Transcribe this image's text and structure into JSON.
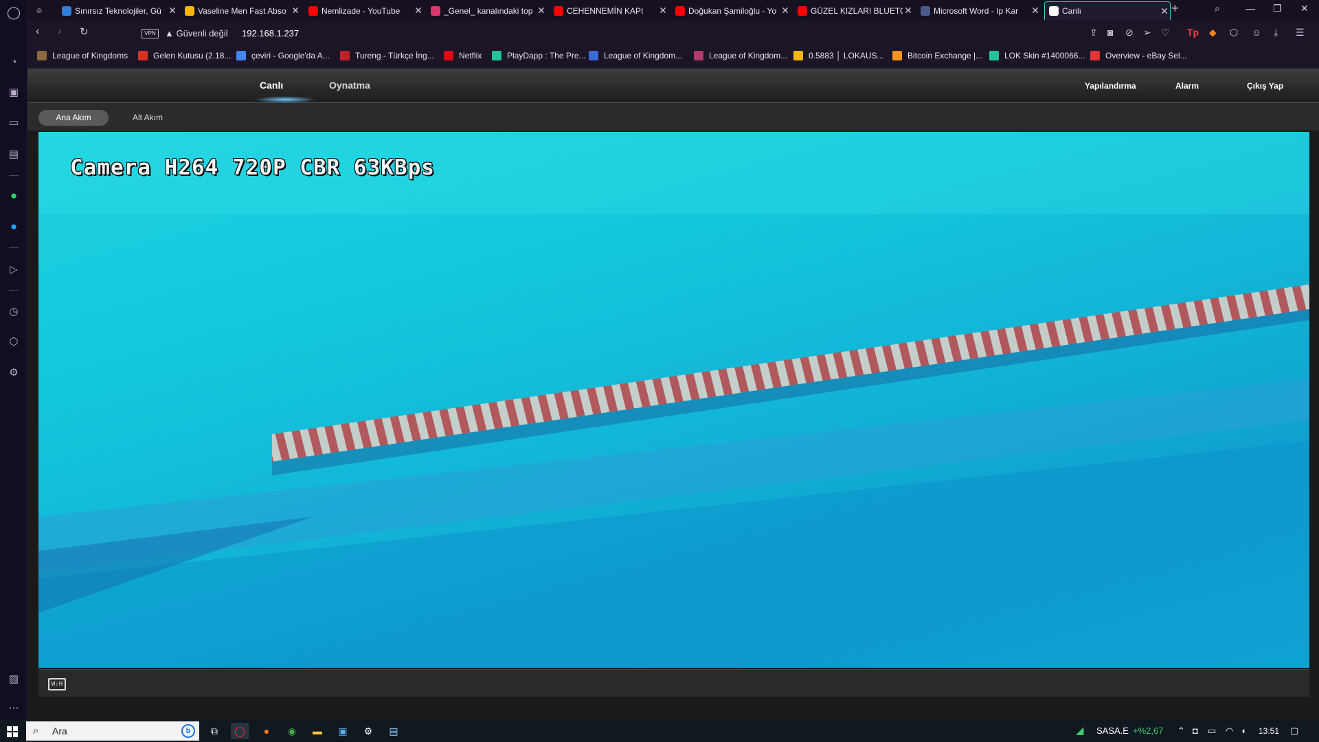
{
  "browser": {
    "tabs": [
      {
        "title": "Sınırsız Teknolojiler, Gü",
        "icon": "triangle-logo-icon",
        "color": "#2f7fd8"
      },
      {
        "title": "Vaseline Men Fast Abso",
        "icon": "walmart-icon",
        "color": "#f7b500"
      },
      {
        "title": "Nemlizade - YouTube",
        "icon": "youtube-icon",
        "color": "#ff0000"
      },
      {
        "title": "_Genel_ kanalındaki top",
        "icon": "play-icon",
        "color": "#e0356e"
      },
      {
        "title": "CEHENNEMİN KAPI",
        "icon": "youtube-icon",
        "color": "#ff0000"
      },
      {
        "title": "Doğukan Şamiloğlu - Yo",
        "icon": "youtube-icon",
        "color": "#ff0000"
      },
      {
        "title": "GÜZEL KIZLARI BLUETO",
        "icon": "youtube-icon",
        "color": "#ff0000"
      },
      {
        "title": "Microsoft Word - Ip Kar",
        "icon": "document-icon",
        "color": "#4a5a8a"
      },
      {
        "title": "Canlı",
        "icon": "globe-icon",
        "color": "#ffffff",
        "active": true
      }
    ],
    "security_label": "Güvenli değil",
    "vpn_label": "VPN",
    "url": "192.168.1.237",
    "bookmarks": [
      {
        "label": "League of Kingdoms",
        "icon": "game-icon",
        "color": "#8a6a3a"
      },
      {
        "label": "Gelen Kutusu (2.18...",
        "icon": "gmail-icon",
        "color": "#d93025"
      },
      {
        "label": "çeviri - Google'da A...",
        "icon": "google-icon",
        "color": "#4285f4"
      },
      {
        "label": "Tureng - Türkçe İng...",
        "icon": "tureng-icon",
        "color": "#c0202a"
      },
      {
        "label": "Netflix",
        "icon": "netflix-icon",
        "color": "#e50914"
      },
      {
        "label": "PlayDapp : The Pre...",
        "icon": "playdapp-icon",
        "color": "#22c39b"
      },
      {
        "label": "League of Kingdom...",
        "icon": "lok-icon",
        "color": "#3a6ad8"
      },
      {
        "label": "League of Kingdom...",
        "icon": "lok-market-icon",
        "color": "#b03a6a"
      },
      {
        "label": "0.5883 │ LOKAUS...",
        "icon": "binance-icon",
        "color": "#f0b90b"
      },
      {
        "label": "Bitcoin Exchange |...",
        "icon": "bitcoin-icon",
        "color": "#f7931a"
      },
      {
        "label": "LOK Skin #1400066...",
        "icon": "opensea-icon",
        "color": "#22c39b"
      },
      {
        "label": "Overview - eBay Sel...",
        "icon": "ebay-icon",
        "color": "#e53238"
      }
    ]
  },
  "app": {
    "nav": {
      "live": "Canlı",
      "playback": "Oynatma",
      "config": "Yapılandırma",
      "alarm": "Alarm",
      "logout": "Çıkış Yap"
    },
    "streams": {
      "main": "Ana Akım",
      "sub": "Alt Akım"
    },
    "video": {
      "osd_text": "Camera H264 720P CBR 63KBps"
    },
    "controls": {
      "stretch_label": "W:H"
    }
  },
  "taskbar": {
    "search_placeholder": "Ara",
    "stock_symbol": "SASA.E",
    "stock_change": "+%2,67",
    "stock_color": "#3ccf6a",
    "clock": "13:51"
  }
}
